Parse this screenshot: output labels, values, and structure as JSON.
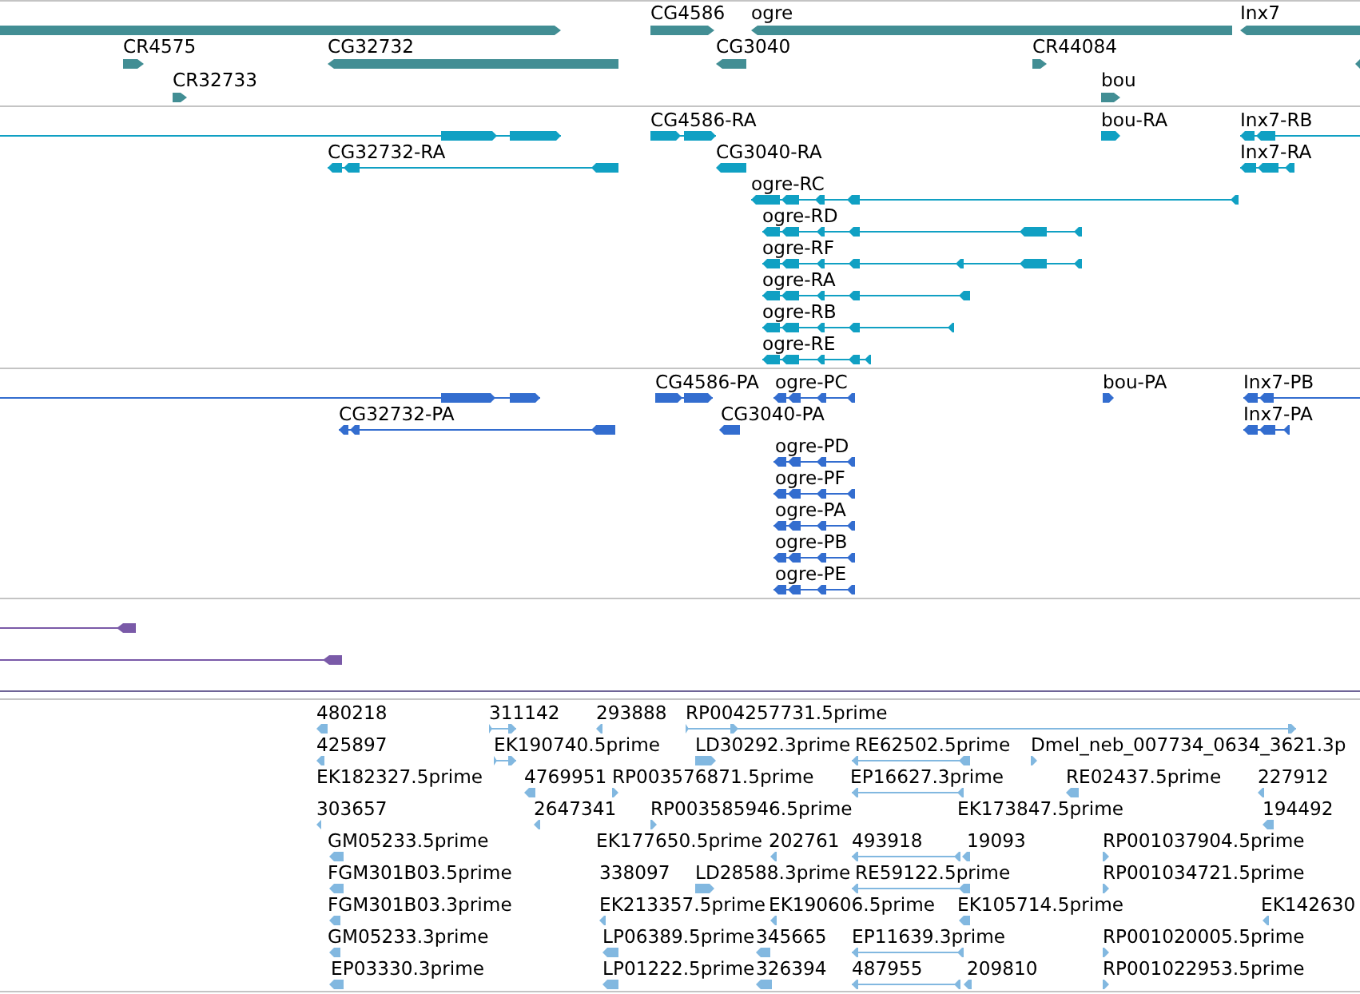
{
  "tracks": [
    {
      "kind": "gene",
      "color": "#428e94",
      "rows": [
        {
          "features": [
            {
              "reverse": false
            },
            {
              "label": "CG4586",
              "reverse": false
            },
            {
              "label": "ogre",
              "reverse": true
            },
            {
              "label": "Inx7",
              "reverse": true
            }
          ]
        },
        {
          "features": [
            {
              "label": "CR4575",
              "reverse": false
            },
            {
              "label": "CG32732",
              "reverse": true
            },
            {
              "label": "CG3040",
              "reverse": true
            },
            {
              "label": "CR44084",
              "reverse": false
            },
            {
              "reverse": true
            }
          ]
        },
        {
          "features": [
            {
              "label": "CR32733",
              "reverse": false
            },
            {
              "label": "bou",
              "reverse": false
            }
          ]
        }
      ]
    },
    {
      "kind": "transcript",
      "color": "#10a0c3",
      "rows": [
        {
          "features": [
            {
              "reverse": false
            },
            {
              "label": "CG4586-RA",
              "reverse": false
            },
            {
              "label": "bou-RA",
              "reverse": false
            },
            {
              "label": "Inx7-RB",
              "reverse": true
            }
          ]
        },
        {
          "features": [
            {
              "label": "CG32732-RA",
              "reverse": true
            },
            {
              "label": "CG3040-RA",
              "reverse": true
            },
            {
              "label": "Inx7-RA",
              "reverse": true
            }
          ]
        },
        {
          "features": [
            {
              "label": "ogre-RC",
              "reverse": true
            }
          ]
        },
        {
          "features": [
            {
              "label": "ogre-RD",
              "reverse": true
            }
          ]
        },
        {
          "features": [
            {
              "label": "ogre-RF",
              "reverse": true
            }
          ]
        },
        {
          "features": [
            {
              "label": "ogre-RA",
              "reverse": true
            }
          ]
        },
        {
          "features": [
            {
              "label": "ogre-RB",
              "reverse": true
            }
          ]
        },
        {
          "features": [
            {
              "label": "ogre-RE",
              "reverse": true
            }
          ]
        }
      ]
    },
    {
      "kind": "protein",
      "color": "#336dcf",
      "rows": [
        {
          "features": [
            {
              "reverse": false
            },
            {
              "label": "CG4586-PA",
              "reverse": false
            },
            {
              "label": "ogre-PC",
              "reverse": true
            },
            {
              "label": "bou-PA",
              "reverse": false
            },
            {
              "label": "Inx7-PB",
              "reverse": true
            }
          ]
        },
        {
          "features": [
            {
              "label": "CG32732-PA",
              "reverse": true
            },
            {
              "label": "CG3040-PA",
              "reverse": true
            },
            {
              "label": "Inx7-PA",
              "reverse": true
            }
          ]
        },
        {
          "features": [
            {
              "label": "ogre-PD",
              "reverse": true
            }
          ]
        },
        {
          "features": [
            {
              "label": "ogre-PF",
              "reverse": true
            }
          ]
        },
        {
          "features": [
            {
              "label": "ogre-PA",
              "reverse": true
            }
          ]
        },
        {
          "features": [
            {
              "label": "ogre-PB",
              "reverse": true
            }
          ]
        },
        {
          "features": [
            {
              "label": "ogre-PE",
              "reverse": true
            }
          ]
        }
      ]
    },
    {
      "kind": "match",
      "color": "#7a5aa8",
      "rows": [
        {
          "features": [
            {
              "reverse": true
            }
          ]
        },
        {
          "features": [
            {
              "reverse": true
            }
          ]
        }
      ]
    },
    {
      "kind": "est",
      "color": "#82b8e0",
      "rows": [
        {
          "features": [
            {
              "label": "480218",
              "reverse": true
            },
            {
              "label": "311142",
              "reverse": false
            },
            {
              "label": "293888",
              "reverse": true
            },
            {
              "label": "RP004257731.5prime",
              "reverse": false
            }
          ]
        },
        {
          "features": [
            {
              "label": "425897",
              "reverse": true
            },
            {
              "label": "EK190740.5prime",
              "reverse": false
            },
            {
              "label": "LD30292.3prime",
              "reverse": false
            },
            {
              "label": "RE62502.5prime",
              "reverse": true
            },
            {
              "label": "Dmel_neb_007734_0634_3621.3p",
              "reverse": false
            }
          ]
        },
        {
          "features": [
            {
              "label": "EK182327.5prime"
            },
            {
              "label": "4769951",
              "reverse": true
            },
            {
              "label": "RP003576871.5prime",
              "reverse": false
            },
            {
              "label": "EP16627.3prime",
              "reverse": true
            },
            {
              "label": "RE02437.5prime",
              "reverse": true
            },
            {
              "label": "227912",
              "reverse": true
            }
          ]
        },
        {
          "features": [
            {
              "label": "303657",
              "reverse": true
            },
            {
              "label": "2647341",
              "reverse": true
            },
            {
              "label": "RP003585946.5prime",
              "reverse": false
            },
            {
              "label": "EK173847.5prime"
            },
            {
              "label": "194492",
              "reverse": true
            }
          ]
        },
        {
          "features": [
            {
              "label": "GM05233.5prime",
              "reverse": true
            },
            {
              "label": "EK177650.5prime"
            },
            {
              "label": "202761",
              "reverse": true
            },
            {
              "label": "493918",
              "reverse": true
            },
            {
              "label": "19093",
              "reverse": true
            },
            {
              "label": "RP001037904.5prime",
              "reverse": false
            }
          ]
        },
        {
          "features": [
            {
              "label": "FGM301B03.5prime",
              "reverse": true
            },
            {
              "label": "338097"
            },
            {
              "label": "LD28588.3prime",
              "reverse": false
            },
            {
              "label": "RE59122.5prime",
              "reverse": true
            },
            {
              "label": "RP001034721.5prime",
              "reverse": false
            }
          ]
        },
        {
          "features": [
            {
              "label": "FGM301B03.3prime",
              "reverse": true
            },
            {
              "label": "EK213357.5prime",
              "reverse": true
            },
            {
              "label": "EK190606.5prime",
              "reverse": true
            },
            {
              "label": "EK105714.5prime",
              "reverse": true
            },
            {
              "label": "EK142630",
              "reverse": true
            }
          ]
        },
        {
          "features": [
            {
              "label": "GM05233.3prime",
              "reverse": true
            },
            {
              "label": "LP06389.5prime",
              "reverse": true
            },
            {
              "label": "345665",
              "reverse": true
            },
            {
              "label": "EP11639.3prime",
              "reverse": true
            },
            {
              "label": "RP001020005.5prime",
              "reverse": false
            }
          ]
        },
        {
          "features": [
            {
              "label": "EP03330.3prime",
              "reverse": true
            },
            {
              "label": "LP01222.5prime",
              "reverse": true
            },
            {
              "label": "326394",
              "reverse": true
            },
            {
              "label": "487955",
              "reverse": true
            },
            {
              "label": "209810",
              "reverse": true
            },
            {
              "label": "RP001022953.5prime",
              "reverse": false
            }
          ]
        }
      ]
    }
  ]
}
